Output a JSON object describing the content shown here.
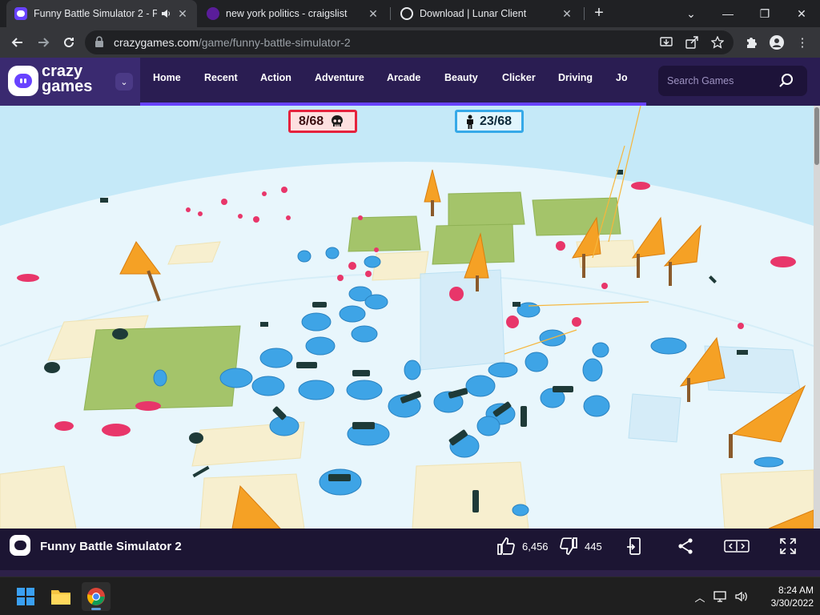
{
  "browser": {
    "tabs": [
      {
        "title": "Funny Battle Simulator 2 - Pl",
        "active": true,
        "favicon": "crazygames-icon",
        "audio": true
      },
      {
        "title": "new york politics - craigslist",
        "active": false,
        "favicon": "craigslist-icon"
      },
      {
        "title": "Download | Lunar Client",
        "active": false,
        "favicon": "lunar-client-icon"
      }
    ],
    "url_domain": "crazygames.com",
    "url_path": "/game/funny-battle-simulator-2"
  },
  "site": {
    "logo_line1": "crazy",
    "logo_line2": "games",
    "nav": [
      "Home",
      "Recent",
      "Action",
      "Adventure",
      "Arcade",
      "Beauty",
      "Clicker",
      "Driving",
      "Jo"
    ],
    "search_placeholder": "Search Games",
    "brand_color": "#6842ff"
  },
  "game": {
    "red_score": "8/68",
    "blue_score": "23/68",
    "red_color": "#e5223d",
    "blue_color": "#36a9e8"
  },
  "gamebar": {
    "title": "Funny Battle Simulator 2",
    "likes": "6,456",
    "dislikes": "445"
  },
  "taskbar": {
    "time": "8:24 AM",
    "date": "3/30/2022"
  }
}
